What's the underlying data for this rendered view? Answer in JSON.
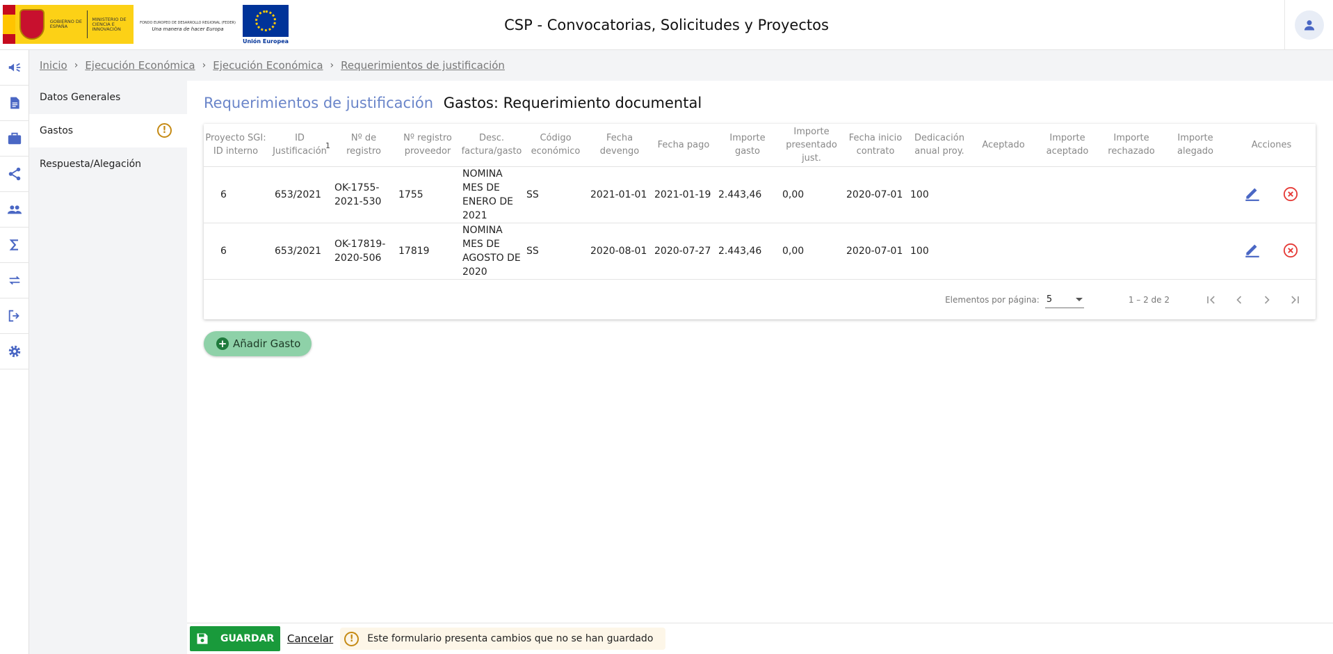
{
  "header": {
    "gob_text": "Gobierno de España",
    "ministerio_text": "Ministerio de Ciencia e Innovación",
    "feder_line1": "FONDO EUROPEO DE DESARROLLO REGIONAL (FEDER)",
    "feder_line2": "Una manera de hacer Europa",
    "eu_label": "Unión Europea",
    "app_title": "CSP - Convocatorias, Solicitudes y Proyectos"
  },
  "rail": {
    "icons": [
      "megaphone-icon",
      "document-icon",
      "briefcase-icon",
      "share-icon",
      "people-icon",
      "sigma-icon",
      "swap-icon",
      "logout-icon",
      "gear-icon"
    ]
  },
  "breadcrumb": {
    "items": [
      "Inicio",
      "Ejecución Económica",
      "Ejecución Económica",
      "Requerimientos de justificación"
    ]
  },
  "sidenav": {
    "items": [
      {
        "label": "Datos Generales"
      },
      {
        "label": "Gastos"
      },
      {
        "label": "Respuesta/Alegación"
      }
    ],
    "warning_symbol": "!"
  },
  "page": {
    "title_prefix": "Requerimientos de justificación",
    "title": "Gastos: Requerimiento documental"
  },
  "table": {
    "columns": [
      "Proyecto SGI: ID interno",
      "ID Justificación",
      "Nº de registro",
      "Nº registro proveedor",
      "Desc. factura/gasto",
      "Código económico",
      "Fecha devengo",
      "Fecha pago",
      "Importe gasto",
      "Importe presentado just.",
      "Fecha inicio contrato",
      "Dedicación anual proy.",
      "Aceptado",
      "Importe aceptado",
      "Importe rechazado",
      "Importe alegado",
      "Acciones"
    ],
    "sort_indicator": "1",
    "rows": [
      [
        "6",
        "653/2021",
        "OK-1755-2021-530",
        "1755",
        "NOMINA MES DE ENERO DE 2021",
        "SS",
        "2021-01-01",
        "2021-01-19",
        "2.443,46",
        "0,00",
        "2020-07-01",
        "100",
        "",
        "",
        "",
        ""
      ],
      [
        "6",
        "653/2021",
        "OK-17819-2020-506",
        "17819",
        "NOMINA MES DE AGOSTO DE 2020",
        "SS",
        "2020-08-01",
        "2020-07-27",
        "2.443,46",
        "0,00",
        "2020-07-01",
        "100",
        "",
        "",
        "",
        ""
      ]
    ]
  },
  "paginator": {
    "label": "Elementos por página:",
    "page_size": "5",
    "range": "1 – 2 de 2"
  },
  "add_button": {
    "label": "Añadir Gasto",
    "symbol": "+"
  },
  "footer": {
    "save_label": "GUARDAR",
    "cancel_label": "Cancelar",
    "warning_text": "Este formulario presenta cambios que no se han guardado",
    "warning_symbol": "!"
  },
  "colors": {
    "accent": "#6a85c9",
    "icon_blue": "#4a67c4",
    "save_green": "#199a3b",
    "add_green": "#8ed1a8",
    "warning": "#c58a14",
    "delete_red": "#e53935"
  }
}
